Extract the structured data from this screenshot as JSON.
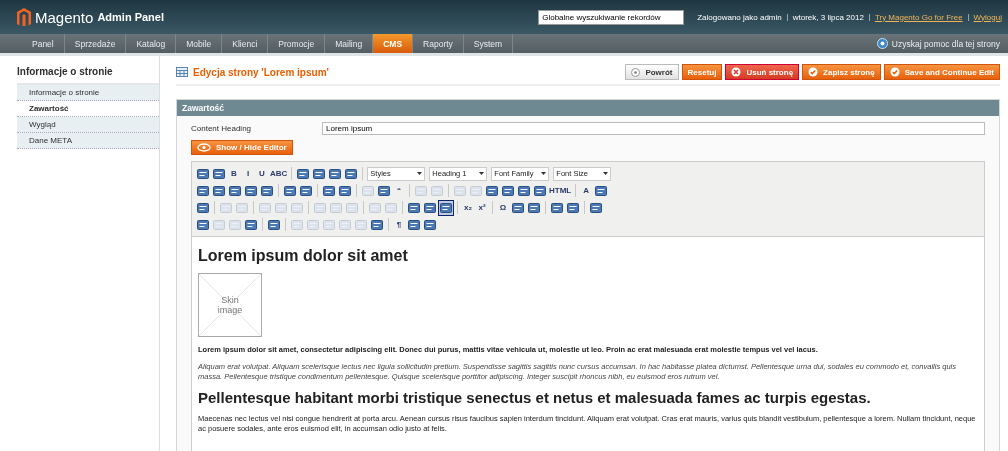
{
  "header": {
    "logo_text": "Magento",
    "logo_suffix": "Admin Panel",
    "search": {
      "value": "Globalne wyszukiwanie rekordów"
    },
    "user_text": "Zalogowano jako admin",
    "date": "wtorek, 3 lipca 2012",
    "links": [
      "Try Magento Go for Free",
      "Wyloguj"
    ]
  },
  "nav": {
    "items": [
      {
        "label": "Panel",
        "selected": false
      },
      {
        "label": "Sprzedaże",
        "selected": false
      },
      {
        "label": "Katalog",
        "selected": false
      },
      {
        "label": "Mobile",
        "selected": false
      },
      {
        "label": "Klienci",
        "selected": false
      },
      {
        "label": "Promocje",
        "selected": false
      },
      {
        "label": "Mailing",
        "selected": false
      },
      {
        "label": "CMS",
        "selected": true
      },
      {
        "label": "Raporty",
        "selected": false
      },
      {
        "label": "System",
        "selected": false
      }
    ],
    "help": "Uzyskaj pomoc dla tej strony"
  },
  "sidebar": {
    "title": "Informacje o stronie",
    "items": [
      {
        "label": "Informacje o stronie",
        "selected": false
      },
      {
        "label": "Zawartość",
        "selected": true
      },
      {
        "label": "Wygląd",
        "selected": false
      },
      {
        "label": "Dane META",
        "selected": false
      }
    ]
  },
  "page": {
    "title": "Edycja strony 'Lorem ipsum'",
    "buttons": [
      {
        "label": "Powrót",
        "kind": "back"
      },
      {
        "label": "Resetuj",
        "kind": "plain"
      },
      {
        "label": "Usuń stronę",
        "kind": "delete"
      },
      {
        "label": "Zapisz stronę",
        "kind": "save"
      },
      {
        "label": "Save and Continue Edit",
        "kind": "save"
      }
    ]
  },
  "section": {
    "title": "Zawartość",
    "field_label": "Content Heading",
    "field_value": "Lorem ipsum",
    "toggle_button": "Show / Hide Editor"
  },
  "toolbar": [
    [
      {
        "kind": "icon",
        "disabled": false
      },
      {
        "kind": "icon",
        "disabled": false
      },
      {
        "kind": "glyph",
        "label": "B"
      },
      {
        "kind": "glyph",
        "label": "I"
      },
      {
        "kind": "glyph",
        "label": "U"
      },
      {
        "kind": "glyph",
        "label": "ABC"
      },
      {
        "kind": "sep"
      },
      {
        "kind": "icon",
        "disabled": false
      },
      {
        "kind": "icon",
        "disabled": false
      },
      {
        "kind": "icon",
        "disabled": false
      },
      {
        "kind": "icon",
        "disabled": false
      },
      {
        "kind": "sep"
      },
      {
        "kind": "select",
        "label": "Styles"
      },
      {
        "kind": "select",
        "label": "Heading 1"
      },
      {
        "kind": "select",
        "label": "Font Family"
      },
      {
        "kind": "select",
        "label": "Font Size"
      }
    ],
    [
      {
        "kind": "icon",
        "disabled": false
      },
      {
        "kind": "icon",
        "disabled": false
      },
      {
        "kind": "icon",
        "disabled": false
      },
      {
        "kind": "icon",
        "disabled": false
      },
      {
        "kind": "icon",
        "disabled": false
      },
      {
        "kind": "sep"
      },
      {
        "kind": "icon",
        "disabled": false
      },
      {
        "kind": "icon",
        "disabled": false
      },
      {
        "kind": "sep"
      },
      {
        "kind": "icon",
        "disabled": false
      },
      {
        "kind": "icon",
        "disabled": false
      },
      {
        "kind": "sep"
      },
      {
        "kind": "icon",
        "disabled": true
      },
      {
        "kind": "icon",
        "disabled": false
      },
      {
        "kind": "glyph",
        "label": "“"
      },
      {
        "kind": "sep"
      },
      {
        "kind": "icon",
        "disabled": true
      },
      {
        "kind": "icon",
        "disabled": true
      },
      {
        "kind": "sep"
      },
      {
        "kind": "icon",
        "disabled": true
      },
      {
        "kind": "icon",
        "disabled": true
      },
      {
        "kind": "icon",
        "disabled": false
      },
      {
        "kind": "icon",
        "disabled": false
      },
      {
        "kind": "icon",
        "disabled": false
      },
      {
        "kind": "icon",
        "disabled": false
      },
      {
        "kind": "glyph",
        "label": "HTML"
      },
      {
        "kind": "sep"
      },
      {
        "kind": "glyph",
        "label": "A"
      },
      {
        "kind": "icon",
        "disabled": false
      }
    ],
    [
      {
        "kind": "icon",
        "disabled": false
      },
      {
        "kind": "sep"
      },
      {
        "kind": "icon",
        "disabled": true
      },
      {
        "kind": "icon",
        "disabled": true
      },
      {
        "kind": "sep"
      },
      {
        "kind": "icon",
        "disabled": true
      },
      {
        "kind": "icon",
        "disabled": true
      },
      {
        "kind": "icon",
        "disabled": true
      },
      {
        "kind": "sep"
      },
      {
        "kind": "icon",
        "disabled": true
      },
      {
        "kind": "icon",
        "disabled": true
      },
      {
        "kind": "icon",
        "disabled": true
      },
      {
        "kind": "sep"
      },
      {
        "kind": "icon",
        "disabled": true
      },
      {
        "kind": "icon",
        "disabled": true
      },
      {
        "kind": "sep"
      },
      {
        "kind": "icon",
        "disabled": false
      },
      {
        "kind": "icon",
        "disabled": false
      },
      {
        "kind": "icon",
        "disabled": false,
        "selected": true
      },
      {
        "kind": "sep"
      },
      {
        "kind": "glyph",
        "label": "x₂"
      },
      {
        "kind": "glyph",
        "label": "x²"
      },
      {
        "kind": "sep"
      },
      {
        "kind": "glyph",
        "label": "Ω"
      },
      {
        "kind": "icon",
        "disabled": false
      },
      {
        "kind": "icon",
        "disabled": false
      },
      {
        "kind": "sep"
      },
      {
        "kind": "icon",
        "disabled": false
      },
      {
        "kind": "icon",
        "disabled": false
      },
      {
        "kind": "sep"
      },
      {
        "kind": "icon",
        "disabled": false
      }
    ],
    [
      {
        "kind": "icon",
        "disabled": false
      },
      {
        "kind": "icon",
        "disabled": true
      },
      {
        "kind": "icon",
        "disabled": true
      },
      {
        "kind": "icon",
        "disabled": false
      },
      {
        "kind": "sep"
      },
      {
        "kind": "icon",
        "disabled": false
      },
      {
        "kind": "sep"
      },
      {
        "kind": "icon",
        "disabled": true
      },
      {
        "kind": "icon",
        "disabled": true
      },
      {
        "kind": "icon",
        "disabled": true
      },
      {
        "kind": "icon",
        "disabled": true
      },
      {
        "kind": "icon",
        "disabled": true
      },
      {
        "kind": "icon",
        "disabled": false
      },
      {
        "kind": "sep"
      },
      {
        "kind": "glyph",
        "label": "¶"
      },
      {
        "kind": "icon",
        "disabled": false
      },
      {
        "kind": "icon",
        "disabled": false
      }
    ]
  ],
  "content": {
    "heading": "Lorem ipsum dolor sit amet",
    "image_label": "Skin image",
    "bold_paragraph": "Lorem ipsum dolor sit amet, consectetur adipiscing elit. Donec dui purus, mattis vitae vehicula ut, molestie ut leo. Proin ac erat malesuada erat molestie tempus vel vel lacus.",
    "italic_paragraph": "Aliquam erat volutpat. Aliquam scelerisque lectus nec ligula sollicitudin pretium. Suspendisse sagittis sagittis nunc cursus accumsan. In hac habitasse platea dictumst. Pellentesque urna dui, sodales eu commodo et, convallis quis massa. Pellentesque tristique condimentum pellentesque. Quisque scelerisque porttitor adipiscing. Integer suscipit rhoncus nibh, eu euismod eros rutrum vel.",
    "heading_2": "Pellentesque habitant morbi tristique senectus et netus et malesuada fames ac turpis egestas.",
    "paragraph": "Maecenas nec lectus vel nisi congue hendrerit at porta arcu. Aenean cursus risus faucibus sapien interdum tincidunt. Aliquam erat volutpat. Cras erat mauris, varius quis blandit vestibulum, pellentesque a lorem. Nullam tincidunt, neque ac posuere sodales, ante eros euismod elit, in accumsan odio justo at felis."
  }
}
